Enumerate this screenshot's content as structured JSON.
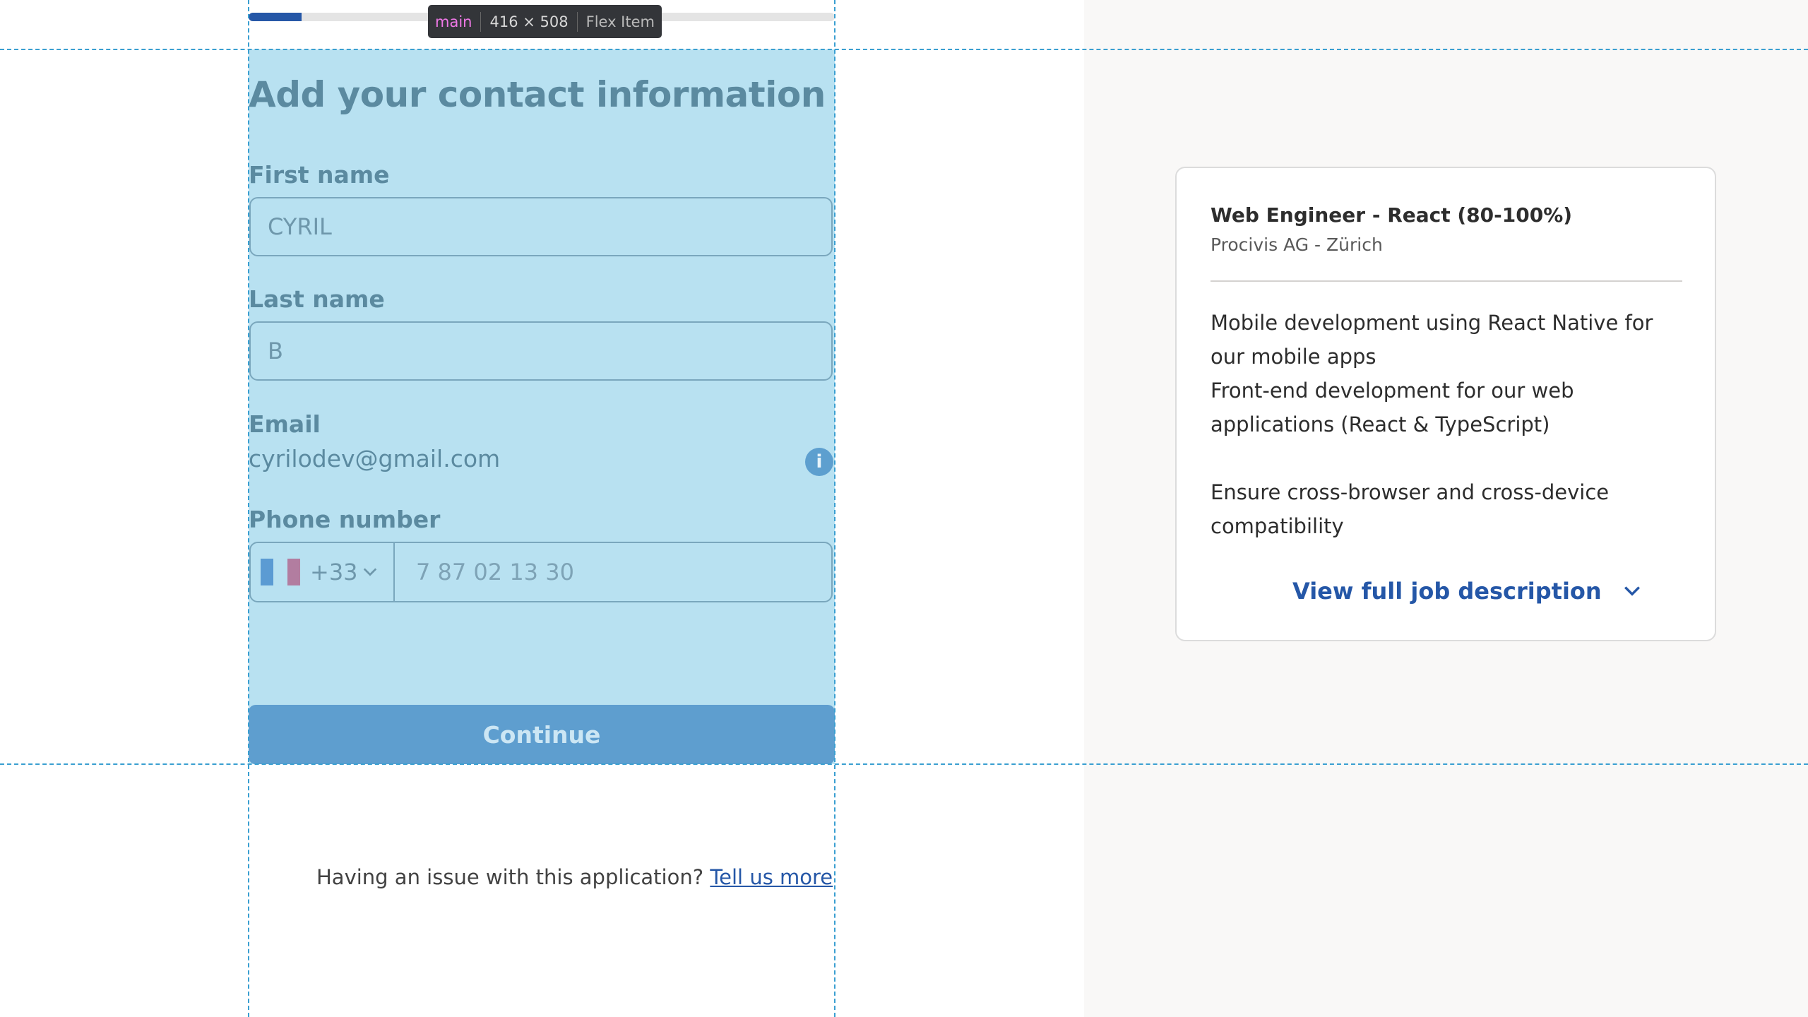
{
  "devtools_tooltip": {
    "tag": "main",
    "size": "416 × 508",
    "kind": "Flex Item"
  },
  "progress": {
    "fraction": 0.09
  },
  "form": {
    "title": "Add your contact information",
    "first_name": {
      "label": "First name",
      "value": "CYRIL"
    },
    "last_name": {
      "label": "Last name",
      "value": "B"
    },
    "email": {
      "label": "Email",
      "value": "cyrilodev@gmail.com",
      "info_icon": "info-icon"
    },
    "phone": {
      "label": "Phone number",
      "country_code": "+33",
      "flag_icon": "france-flag-icon",
      "placeholder": "7 87 02 13 30"
    },
    "continue_label": "Continue"
  },
  "footer": {
    "issue_text": "Having an issue with this application?",
    "issue_link": "Tell us more"
  },
  "job": {
    "title": "Web Engineer - React (80-100%)",
    "company": "Procivis AG - Zürich",
    "description": [
      "Mobile development using React Native for our mobile apps",
      "Front-end development for our web applications (React & TypeScript)",
      "",
      "Ensure cross-browser and cross-device compatibility"
    ],
    "view_full_label": "View full job description"
  },
  "colors": {
    "accent": "#2557a7",
    "devtools_highlight": "#b8e1f1",
    "devtools_guide": "#3a9fd1",
    "side_background": "#f9f8f7"
  }
}
